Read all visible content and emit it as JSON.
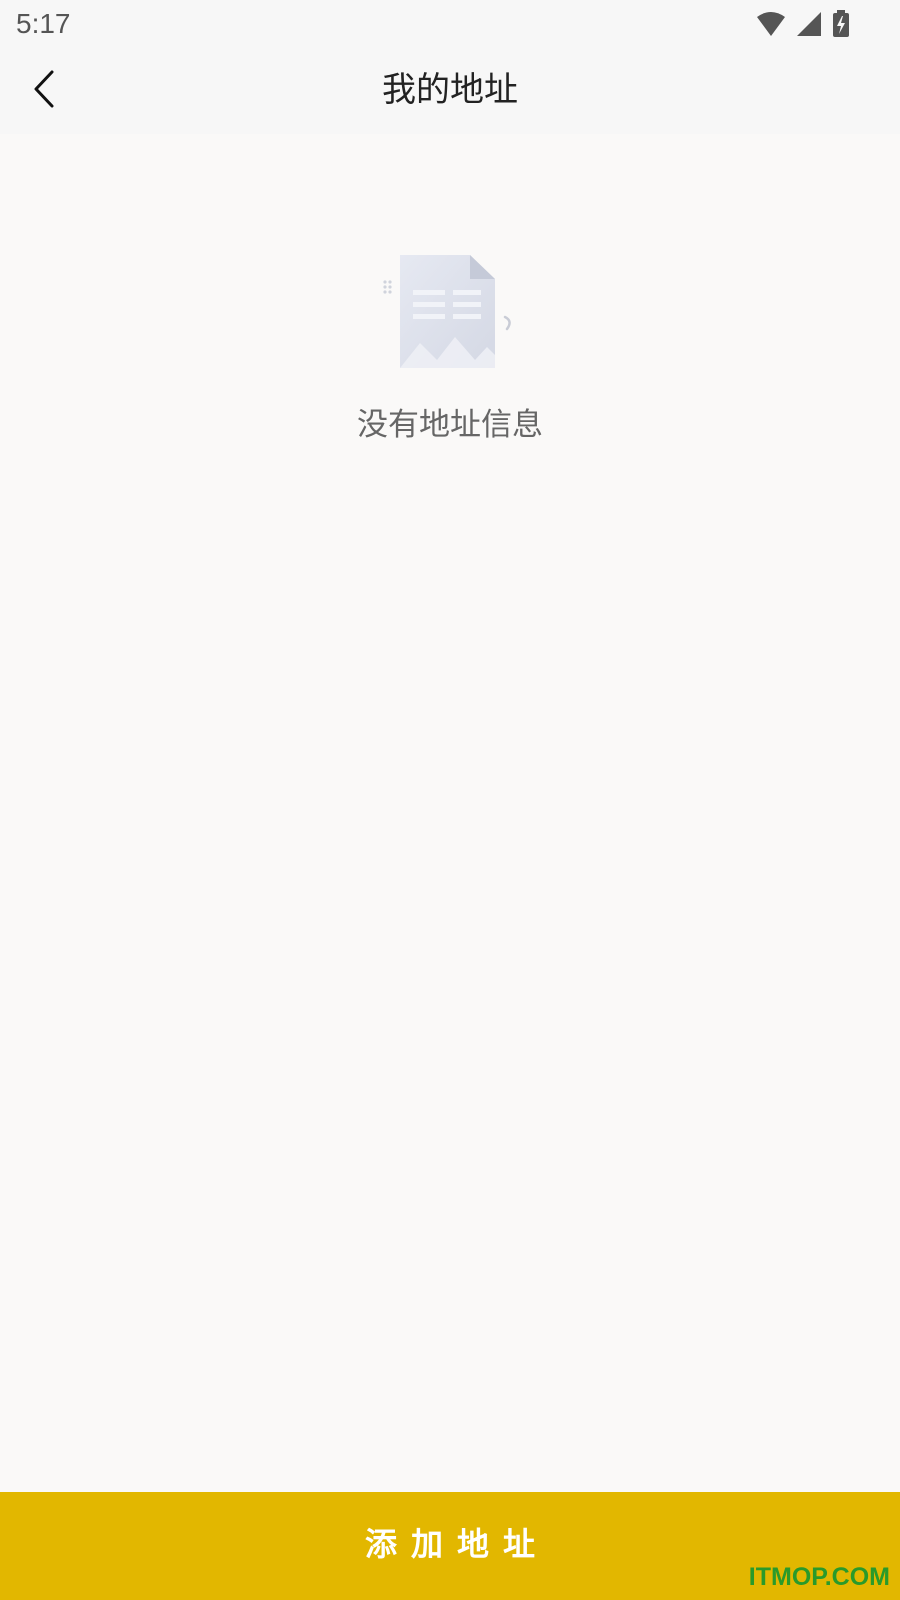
{
  "status_bar": {
    "time": "5:17",
    "icons": [
      "wifi-icon",
      "signal-icon",
      "battery-charging-icon"
    ]
  },
  "header": {
    "title": "我的地址",
    "back_icon": "chevron-left-icon"
  },
  "empty_state": {
    "icon": "empty-document-icon",
    "message": "没有地址信息"
  },
  "footer": {
    "add_button_label": "添加地址"
  },
  "watermark": "ITMOP.COM",
  "colors": {
    "accent": "#e2b700",
    "background": "#faf9f8",
    "header_background": "#f7f7f7",
    "watermark": "#2a9a2a"
  }
}
